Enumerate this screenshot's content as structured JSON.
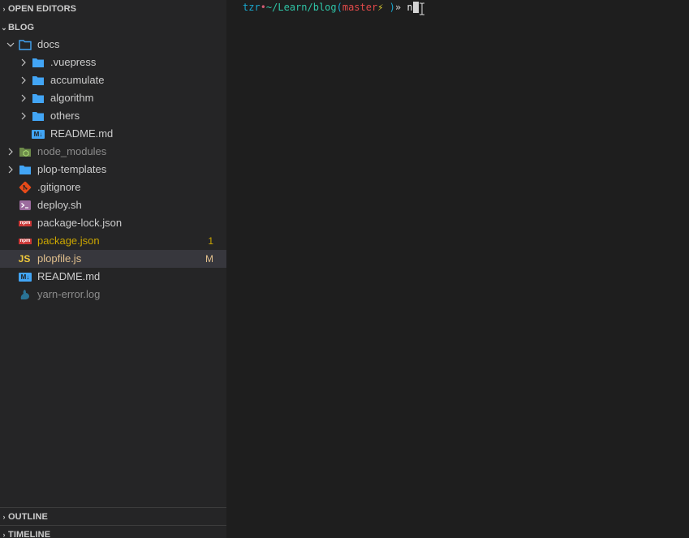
{
  "sidebar": {
    "open_editors_title": "OPEN EDITORS",
    "project_title": "BLOG",
    "outline_title": "OUTLINE",
    "timeline_title": "TIMELINE",
    "items": [
      {
        "label": "docs",
        "icon": "folder-open-icon"
      },
      {
        "label": ".vuepress",
        "icon": "folder-icon"
      },
      {
        "label": "accumulate",
        "icon": "folder-icon"
      },
      {
        "label": "algorithm",
        "icon": "folder-icon"
      },
      {
        "label": "others",
        "icon": "folder-icon"
      },
      {
        "label": "README.md",
        "icon": "markdown-icon",
        "icon_text": "M↓"
      },
      {
        "label": "node_modules",
        "icon": "node-folder-icon"
      },
      {
        "label": "plop-templates",
        "icon": "folder-icon"
      },
      {
        "label": ".gitignore",
        "icon": "git-icon"
      },
      {
        "label": "deploy.sh",
        "icon": "shell-icon"
      },
      {
        "label": "package-lock.json",
        "icon": "npm-icon",
        "icon_text": "npm"
      },
      {
        "label": "package.json",
        "icon": "npm-icon",
        "icon_text": "npm",
        "badge": "1"
      },
      {
        "label": "plopfile.js",
        "icon": "javascript-icon",
        "icon_text": "JS",
        "badge": "M"
      },
      {
        "label": "README.md",
        "icon": "markdown-icon",
        "icon_text": "M↓"
      },
      {
        "label": "yarn-error.log",
        "icon": "yarn-icon"
      }
    ]
  },
  "terminal": {
    "user": "tzr",
    "separator": "•",
    "path": "~/Learn/blog",
    "open_paren": "(",
    "branch": "master",
    "bolt": "⚡",
    "close_paren": " )",
    "arrow": "»",
    "command": " n"
  },
  "colors": {
    "sidebar_bg": "#252526",
    "editor_bg": "#1e1e1e",
    "folder": "#42a5f5",
    "modified": "#e2c08d",
    "warning": "#cca700"
  }
}
